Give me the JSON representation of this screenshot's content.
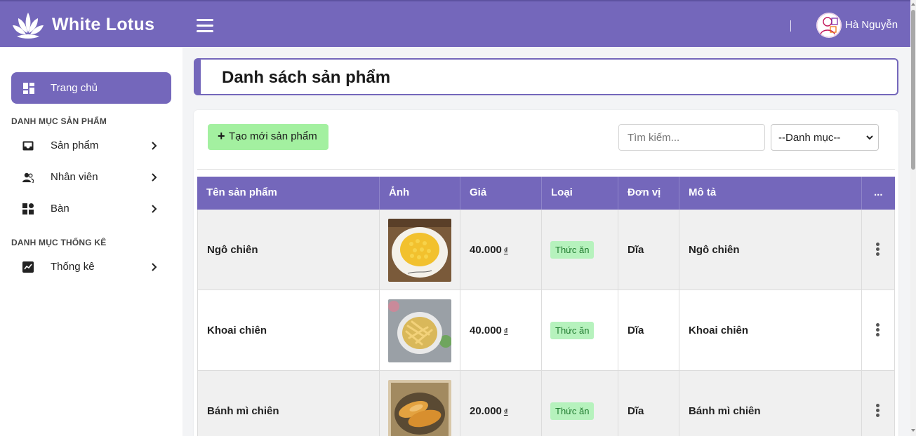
{
  "header": {
    "brand": "White Lotus",
    "username": "Hà Nguyễn",
    "accent_color": "#7467bb"
  },
  "sidebar": {
    "home": {
      "label": "Trang chủ",
      "icon": "dashboard-icon"
    },
    "sections": [
      {
        "title": "DANH MỤC SẢN PHẨM"
      },
      {
        "title": "DANH MỤC THỐNG KÊ"
      }
    ],
    "items": [
      {
        "label": "Sản phẩm",
        "icon": "inbox-icon"
      },
      {
        "label": "Nhân viên",
        "icon": "users-icon"
      },
      {
        "label": "Bàn",
        "icon": "grid-icon"
      },
      {
        "label": "Thống kê",
        "icon": "chart-icon"
      }
    ]
  },
  "page": {
    "title": "Danh sách sản phẩm"
  },
  "toolbar": {
    "create_label": "Tạo mới sản phẩm",
    "search_placeholder": "Tìm kiếm...",
    "category_selected": "--Danh mục--"
  },
  "table": {
    "headers": [
      "Tên sản phẩm",
      "Ảnh",
      "Giá",
      "Loại",
      "Đơn vị",
      "Mô tả",
      "..."
    ],
    "rows": [
      {
        "name": "Ngô chiên",
        "price": "40.000",
        "currency": "₫",
        "type": "Thức ăn",
        "unit": "Dĩa",
        "description": "Ngô chiên",
        "image": "fried-corn-photo"
      },
      {
        "name": "Khoai chiên",
        "price": "40.000",
        "currency": "₫",
        "type": "Thức ăn",
        "unit": "Dĩa",
        "description": "Khoai chiên",
        "image": "french-fries-photo"
      },
      {
        "name": "Bánh mì chiên",
        "price": "20.000",
        "currency": "₫",
        "type": "Thức ăn",
        "unit": "Dĩa",
        "description": "Bánh mì chiên",
        "image": "fried-bread-photo"
      }
    ]
  }
}
